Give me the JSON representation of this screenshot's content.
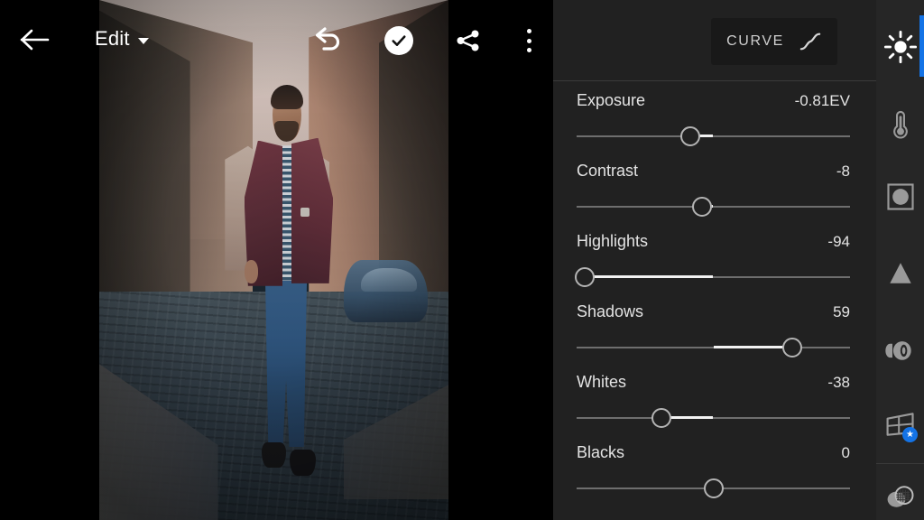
{
  "app": {
    "screen_title": "Edit",
    "background": "#000000",
    "panel_bg": "#212121",
    "sidebar_bg": "#262626",
    "accent": "#1473e6"
  },
  "topbar": {
    "back_icon": "back-arrow-icon",
    "title": "Edit",
    "title_caret_icon": "chevron-down-icon",
    "undo_icon": "undo-icon",
    "confirm_icon": "check-icon",
    "share_icon": "share-icon",
    "more_icon": "more-vertical-icon"
  },
  "panel": {
    "curve_button": {
      "label": "CURVE",
      "icon": "tone-curve-icon"
    },
    "sliders": [
      {
        "name": "Exposure",
        "value": "-0.81EV",
        "pos": 41.7,
        "center": 50.0
      },
      {
        "name": "Contrast",
        "value": "-8",
        "pos": 45.8,
        "center": 50.0
      },
      {
        "name": "Highlights",
        "value": "-94",
        "pos": 3.0,
        "center": 50.0
      },
      {
        "name": "Shadows",
        "value": "59",
        "pos": 78.8,
        "center": 50.0
      },
      {
        "name": "Whites",
        "value": "-38",
        "pos": 31.0,
        "center": 50.0
      },
      {
        "name": "Blacks",
        "value": "0",
        "pos": 50.0,
        "center": 50.0
      }
    ]
  },
  "sidebar": {
    "items": [
      {
        "name": "light-panel",
        "icon": "sun-icon",
        "selected": true,
        "badge": ""
      },
      {
        "name": "color-panel",
        "icon": "thermometer-icon",
        "selected": false,
        "badge": ""
      },
      {
        "name": "effects-panel",
        "icon": "effects-icon",
        "selected": false,
        "badge": ""
      },
      {
        "name": "detail-panel",
        "icon": "detail-triangle-icon",
        "selected": false,
        "badge": ""
      },
      {
        "name": "optics-panel",
        "icon": "lens-icon",
        "selected": false,
        "badge": ""
      },
      {
        "name": "geometry-panel",
        "icon": "geometry-icon",
        "selected": false,
        "badge": "star"
      },
      {
        "name": "healing-panel",
        "icon": "healing-brush-icon",
        "selected": false,
        "badge": ""
      }
    ]
  },
  "photo": {
    "alt_name": "street-photo-man-walking"
  }
}
